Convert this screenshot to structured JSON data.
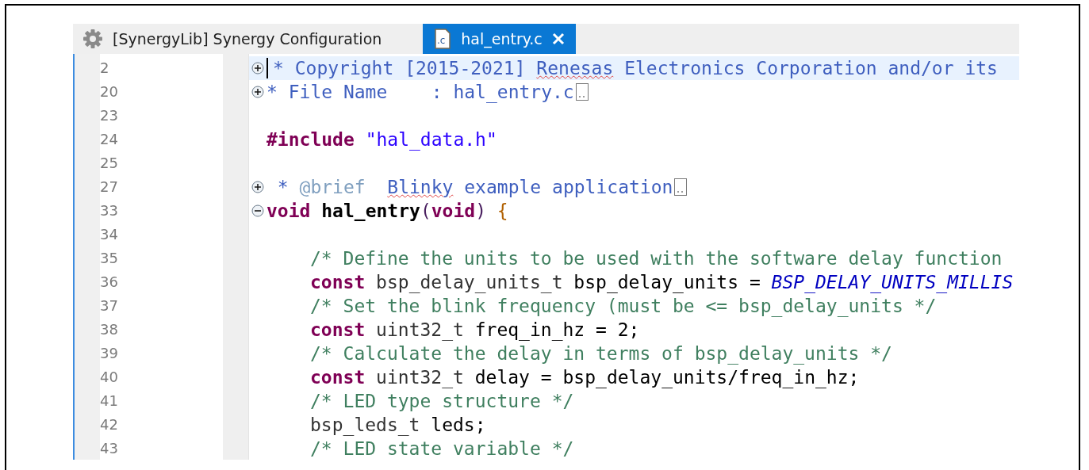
{
  "tabs": [
    {
      "label": "[SynergyLib] Synergy Configuration",
      "kind": "settings",
      "selected": false,
      "closable": false
    },
    {
      "label": "hal_entry.c",
      "kind": "source",
      "icon_text": ".c",
      "selected": true,
      "closable": true
    }
  ],
  "editor": {
    "lines": [
      {
        "number": "2",
        "kind": "folded",
        "indented": false,
        "current": true,
        "cursor": true,
        "folded_marker": false,
        "tokens": [
          {
            "text": "* Copyright [2015-2021] ",
            "kind": "doc"
          },
          {
            "text": "Renesas",
            "kind": "doc",
            "misspelled": true
          },
          {
            "text": " Electronics Corporation and/or its",
            "kind": "doc"
          }
        ]
      },
      {
        "number": "20",
        "kind": "folded",
        "indented": false,
        "current": false,
        "cursor": false,
        "folded_marker": true,
        "tokens": [
          {
            "text": "* File Name    : hal_entry.c",
            "kind": "doc"
          }
        ]
      },
      {
        "number": "23",
        "kind": "plain",
        "current": false,
        "cursor": false,
        "folded_marker": false
      },
      {
        "number": "24",
        "kind": "plain",
        "indented": false,
        "current": false,
        "cursor": false,
        "folded_marker": false,
        "tokens": [
          {
            "text": "#include ",
            "kind": "keyword"
          },
          {
            "text": "\"hal_data.h\"",
            "kind": "string"
          }
        ]
      },
      {
        "number": "25",
        "kind": "plain",
        "current": false,
        "cursor": false,
        "folded_marker": false
      },
      {
        "number": "27",
        "kind": "folded",
        "indented": false,
        "current": false,
        "cursor": false,
        "folded_marker": true,
        "tokens": [
          {
            "text": " * ",
            "kind": "doc"
          },
          {
            "text": "@brief  ",
            "kind": "doctag"
          },
          {
            "text": "Blinky",
            "kind": "doc",
            "misspelled": true
          },
          {
            "text": " example application",
            "kind": "doc"
          }
        ]
      },
      {
        "number": "33",
        "kind": "expanded",
        "indented": false,
        "current": false,
        "cursor": false,
        "folded_marker": false,
        "tokens": [
          {
            "text": "void ",
            "kind": "keyword"
          },
          {
            "text": "hal_entry",
            "kind": "function"
          },
          {
            "text": "(",
            "kind": "paren"
          },
          {
            "text": "void",
            "kind": "keyword"
          },
          {
            "text": ") ",
            "kind": "paren"
          },
          {
            "text": "{",
            "kind": "brace"
          }
        ]
      },
      {
        "number": "34",
        "kind": "plain",
        "current": false,
        "cursor": false,
        "folded_marker": false
      },
      {
        "number": "35",
        "kind": "plain",
        "indented": true,
        "current": false,
        "cursor": false,
        "folded_marker": false,
        "tokens": [
          {
            "text": "/* Define the units to be used with the software delay function",
            "kind": "comment"
          }
        ]
      },
      {
        "number": "36",
        "kind": "plain",
        "indented": true,
        "current": false,
        "cursor": false,
        "folded_marker": false,
        "tokens": [
          {
            "text": "const",
            "kind": "keyword"
          },
          {
            "text": " bsp_delay_units_t ",
            "kind": "plain"
          },
          {
            "text": "bsp_delay_units = ",
            "kind": "variable"
          },
          {
            "text": "BSP_DELAY_UNITS_MILLIS",
            "kind": "macro"
          }
        ]
      },
      {
        "number": "37",
        "kind": "plain",
        "indented": true,
        "current": false,
        "cursor": false,
        "folded_marker": false,
        "tokens": [
          {
            "text": "/* Set the blink frequency (must be <= bsp_delay_units */",
            "kind": "comment"
          }
        ]
      },
      {
        "number": "38",
        "kind": "plain",
        "indented": true,
        "current": false,
        "cursor": false,
        "folded_marker": false,
        "tokens": [
          {
            "text": "const",
            "kind": "keyword"
          },
          {
            "text": " uint32_t ",
            "kind": "plain"
          },
          {
            "text": "freq_in_hz = 2;",
            "kind": "variable"
          }
        ]
      },
      {
        "number": "39",
        "kind": "plain",
        "indented": true,
        "current": false,
        "cursor": false,
        "folded_marker": false,
        "tokens": [
          {
            "text": "/* Calculate the delay in terms of bsp_delay_units */",
            "kind": "comment"
          }
        ]
      },
      {
        "number": "40",
        "kind": "plain",
        "indented": true,
        "current": false,
        "cursor": false,
        "folded_marker": false,
        "tokens": [
          {
            "text": "const",
            "kind": "keyword"
          },
          {
            "text": " uint32_t ",
            "kind": "plain"
          },
          {
            "text": "delay = bsp_delay_units/freq_in_hz;",
            "kind": "variable"
          }
        ]
      },
      {
        "number": "41",
        "kind": "plain",
        "indented": true,
        "current": false,
        "cursor": false,
        "folded_marker": false,
        "tokens": [
          {
            "text": "/* LED type structure */",
            "kind": "comment"
          }
        ]
      },
      {
        "number": "42",
        "kind": "plain",
        "indented": true,
        "current": false,
        "cursor": false,
        "folded_marker": false,
        "tokens": [
          {
            "text": "bsp_leds_t ",
            "kind": "plain"
          },
          {
            "text": "leds;",
            "kind": "variable"
          }
        ]
      },
      {
        "number": "43",
        "kind": "plain",
        "indented": true,
        "current": false,
        "cursor": false,
        "folded_marker": false,
        "tokens": [
          {
            "text": "/* LED state variable */",
            "kind": "comment"
          }
        ]
      }
    ]
  }
}
